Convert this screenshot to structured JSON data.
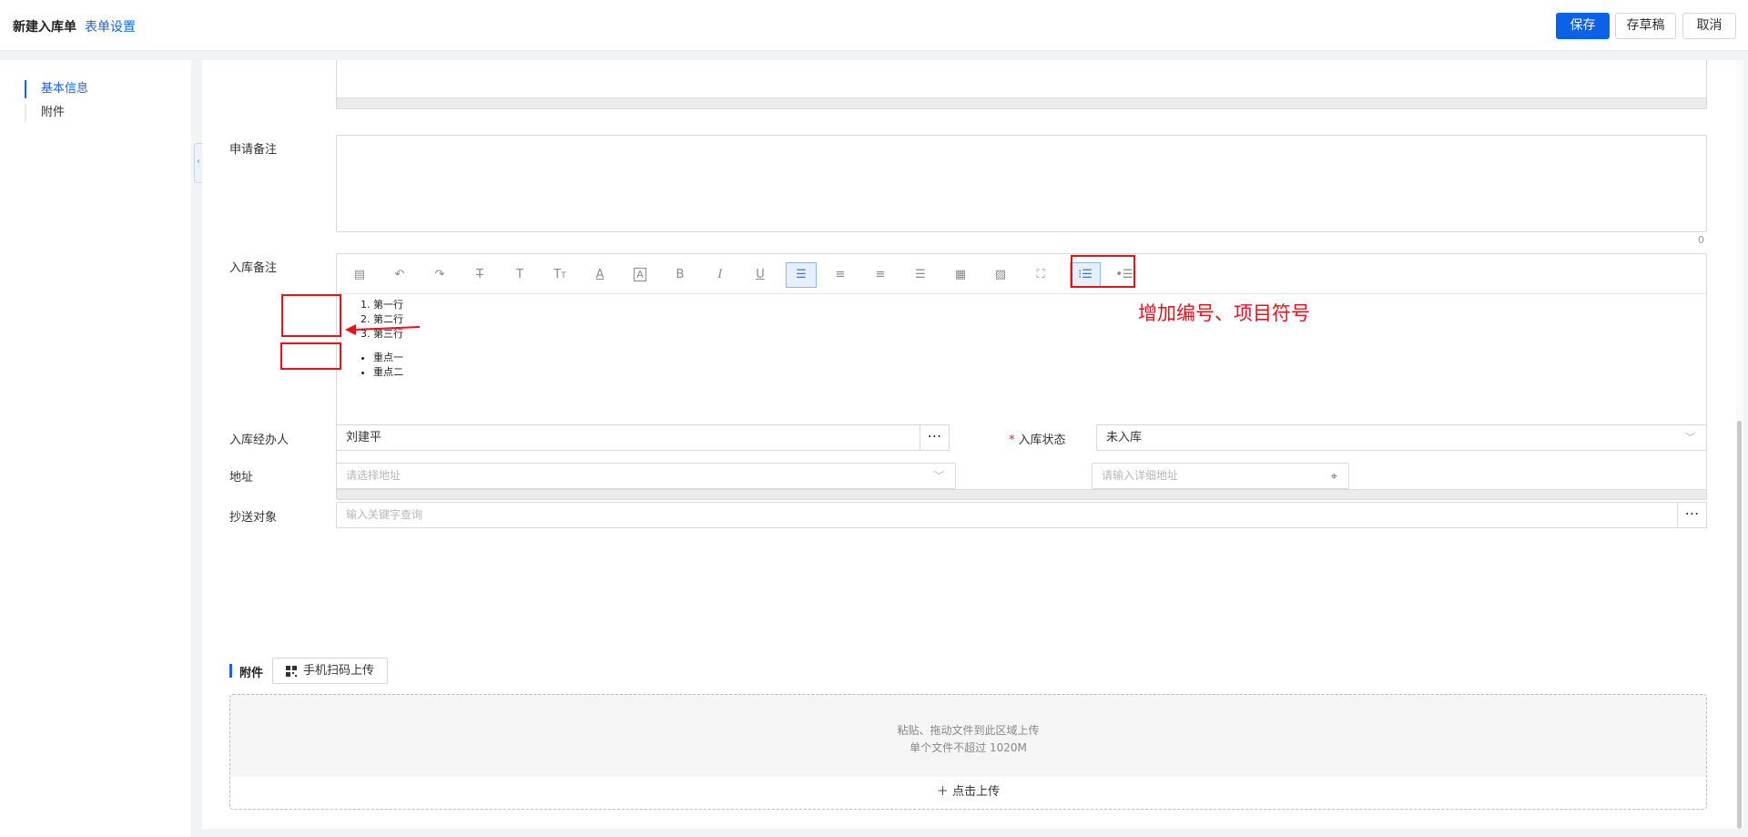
{
  "header": {
    "title": "新建入库单",
    "form_settings": "表单设置",
    "save_label": "保存",
    "draft_label": "存草稿",
    "cancel_label": "取消"
  },
  "sidebar": {
    "items": [
      {
        "label": "基本信息",
        "active": true
      },
      {
        "label": "附件",
        "active": false
      }
    ]
  },
  "form": {
    "apply_remark": {
      "label": "申请备注",
      "char_count": "0"
    },
    "stock_remark": {
      "label": "入库备注",
      "ordered_items": [
        "第一行",
        "第二行",
        "第三行"
      ],
      "bullet_items": [
        "重点一",
        "重点二"
      ]
    },
    "handler": {
      "label": "入库经办人",
      "value": "刘建平"
    },
    "status": {
      "label": "入库状态",
      "value": "未入库"
    },
    "address": {
      "label": "地址",
      "select_placeholder": "请选择地址",
      "detail_placeholder": "请输入详细地址"
    },
    "cc": {
      "label": "抄送对象",
      "placeholder": "输入关键字查询"
    }
  },
  "toolbar_icons": [
    "template-icon",
    "undo-icon",
    "redo-icon",
    "strikethrough-icon",
    "text-icon",
    "font-size-icon",
    "font-color-icon",
    "background-color-icon",
    "bold-icon",
    "italic-icon",
    "underline-icon",
    "align-left-icon",
    "align-center-icon",
    "align-right-icon",
    "justify-icon",
    "table-icon",
    "image-icon",
    "fullscreen-icon",
    "ordered-list-icon",
    "bullet-list-icon"
  ],
  "annotation": {
    "text": "增加编号、项目符号",
    "color": "#e8101c"
  },
  "attachments": {
    "title": "附件",
    "scan_upload": "手机扫码上传",
    "hint_line1": "粘贴、拖动文件到此区域上传",
    "hint_line2": "单个文件不超过 1020M",
    "upload_label": "点击上传"
  },
  "colors": {
    "primary": "#0b62e8",
    "link": "#1565e6",
    "annotation": "#e8101c"
  }
}
